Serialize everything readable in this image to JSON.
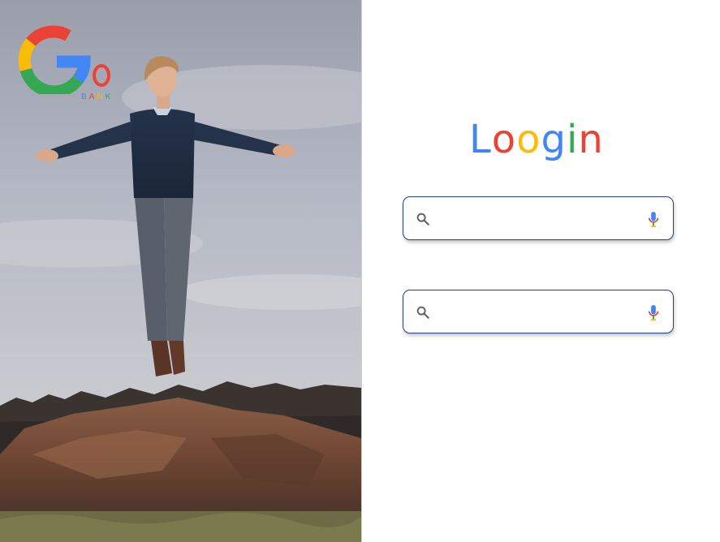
{
  "brand": {
    "logo_letters": [
      "G",
      "o"
    ],
    "logo_subtitle_letters": [
      "B",
      "A",
      "N",
      "K"
    ],
    "logo_subtitle_colors": [
      "#4285F4",
      "#EA4335",
      "#FBBC05",
      "#34A853"
    ]
  },
  "login": {
    "title_letters": [
      "L",
      "o",
      "o",
      "g",
      "i",
      "n"
    ],
    "title_colors": [
      "#4285F4",
      "#EA4335",
      "#FBBC05",
      "#4285F4",
      "#34A853",
      "#EA4335"
    ]
  },
  "fields": [
    {
      "value": "",
      "placeholder": ""
    },
    {
      "value": "",
      "placeholder": ""
    }
  ],
  "icons": {
    "search": "search-icon",
    "mic": "microphone-icon",
    "logo": "go-bank-logo"
  },
  "colors": {
    "field_border": "#1f3f8f",
    "google_blue": "#4285F4",
    "google_red": "#EA4335",
    "google_yellow": "#FBBC05",
    "google_green": "#34A853"
  }
}
